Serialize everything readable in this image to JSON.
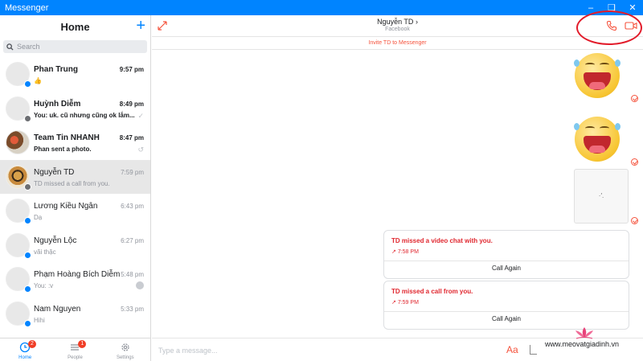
{
  "app": {
    "title": "Messenger",
    "accent": "#0084ff",
    "alert": "#f5533d"
  },
  "window_controls": [
    "minimize",
    "maximize",
    "close"
  ],
  "sidebar": {
    "title": "Home",
    "search_placeholder": "Search",
    "conversations": [
      {
        "name": "Phan Trung",
        "time": "9:57 pm",
        "preview": "",
        "unread": true,
        "badge": "messenger"
      },
      {
        "name": "Huỳnh Diễm",
        "time": "8:49 pm",
        "preview": "You: uk. cũ nhưng cũng ok lắm...",
        "unread": true,
        "badge": "facebook"
      },
      {
        "name": "Team Tin NHANH",
        "time": "8:47 pm",
        "preview": "Phan sent a photo.",
        "unread": true,
        "badge": ""
      },
      {
        "name": "Nguyễn TD",
        "time": "7:59 pm",
        "preview": "TD missed a call from you.",
        "unread": false,
        "badge": "facebook",
        "active": true
      },
      {
        "name": "Lương Kiều Ngân",
        "time": "6:43 pm",
        "preview": "Dạ",
        "unread": false,
        "badge": "messenger"
      },
      {
        "name": "Nguyễn Lộc",
        "time": "6:27 pm",
        "preview": "vãi thặc",
        "unread": false,
        "badge": "messenger"
      },
      {
        "name": "Phạm Hoàng Bích Diễm",
        "time": "5:48 pm",
        "preview": "You: :v",
        "unread": false,
        "badge": "messenger"
      },
      {
        "name": "Nam Nguyen",
        "time": "5:33 pm",
        "preview": "Hihi",
        "unread": false,
        "badge": "messenger"
      }
    ],
    "tabs": [
      {
        "label": "Home",
        "count": "2"
      },
      {
        "label": "People",
        "count": "1"
      },
      {
        "label": "Settings",
        "count": ""
      }
    ]
  },
  "chat": {
    "contact_name": "Nguyễn TD",
    "contact_sub": "Facebook",
    "invite_text": "Invite TD to Messenger",
    "cards": [
      {
        "title": "TD missed a video chat with you.",
        "time": "7:58 PM",
        "action": "Call Again"
      },
      {
        "title": "TD missed a call from you.",
        "time": "7:59 PM",
        "action": "Call Again"
      }
    ],
    "composer_placeholder": "Type a message...",
    "font_button": "Aa"
  },
  "watermark": {
    "text": "www.meovatgiadinh.vn"
  }
}
